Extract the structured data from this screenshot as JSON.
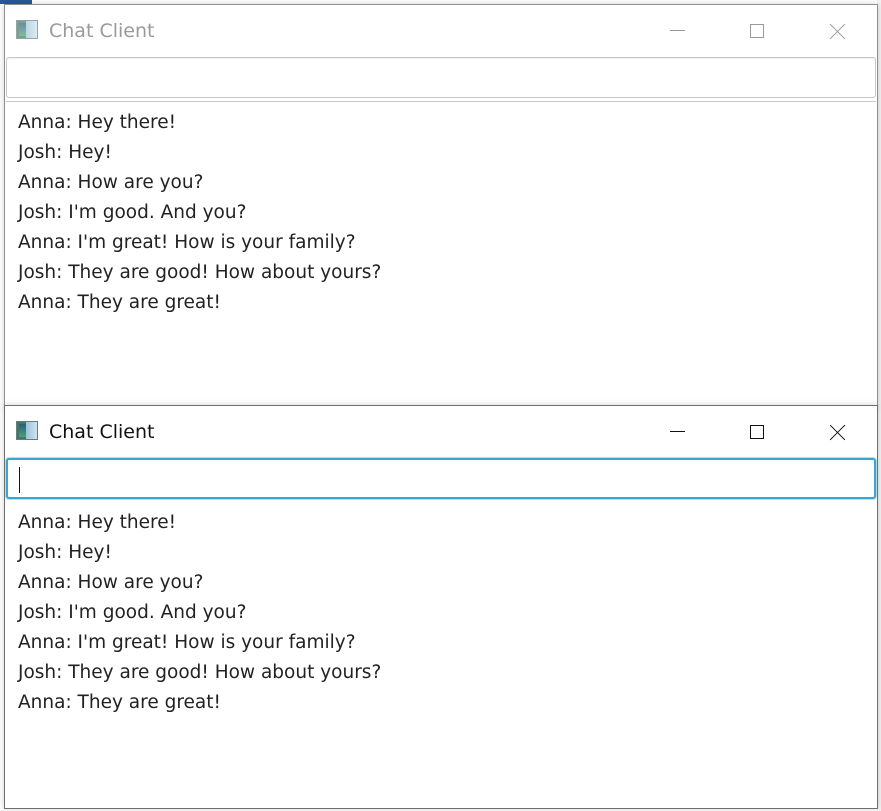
{
  "windows": [
    {
      "id": "back",
      "title": "Chat Client",
      "input_value": "",
      "messages": [
        "Anna: Hey there!",
        "Josh: Hey!",
        "Anna: How are you?",
        "Josh: I'm good. And you?",
        "Anna: I'm great! How is your family?",
        "Josh: They are good! How about yours?",
        "Anna: They are great!"
      ],
      "icons": {
        "app": "chat-app-icon",
        "minimize": "minimize-icon",
        "maximize": "maximize-icon",
        "close": "close-icon"
      },
      "focused": false
    },
    {
      "id": "front",
      "title": "Chat Client",
      "input_value": "",
      "messages": [
        "Anna: Hey there!",
        "Josh: Hey!",
        "Anna: How are you?",
        "Josh: I'm good. And you?",
        "Anna: I'm great! How is your family?",
        "Josh: They are good! How about yours?",
        "Anna: They are great!"
      ],
      "icons": {
        "app": "chat-app-icon",
        "minimize": "minimize-icon",
        "maximize": "maximize-icon",
        "close": "close-icon"
      },
      "focused": true
    }
  ],
  "colors": {
    "focus_border": "#3aa6cd",
    "inactive_title": "#9a9a9a",
    "text": "#222222"
  }
}
